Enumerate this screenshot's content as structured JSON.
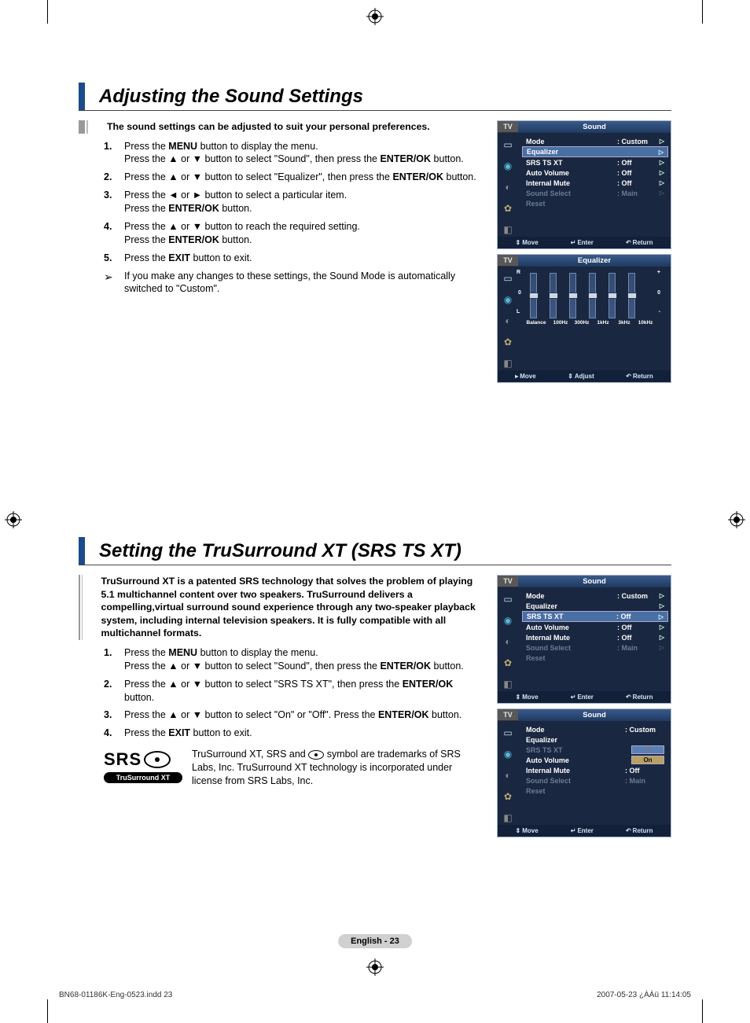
{
  "section1": {
    "title": "Adjusting the Sound Settings",
    "intro": "The sound settings can be adjusted to suit your personal preferences.",
    "steps": [
      {
        "num": "1.",
        "a": "Press the ",
        "b1": "MENU",
        "c": " button to display the menu.",
        "d": "Press the ▲ or ▼ button to select \"Sound\", then press the ",
        "b2": "ENTER/OK",
        "e": " button."
      },
      {
        "num": "2.",
        "a": "Press the ▲ or ▼ button to select \"Equalizer\", then press the ",
        "b1": "ENTER/OK",
        "c": " button."
      },
      {
        "num": "3.",
        "a": "Press the ◄ or ► button to select a particular item.",
        "d": "Press the ",
        "b2": "ENTER/OK",
        "e": " button."
      },
      {
        "num": "4.",
        "a": "Press the ▲ or ▼ button to reach the required setting.",
        "d": "Press the ",
        "b2": "ENTER/OK",
        "e": " button."
      },
      {
        "num": "5.",
        "a": "Press the ",
        "b1": "EXIT",
        "c": " button to exit."
      }
    ],
    "note_arrow": "➢",
    "note": "If you make any changes to these settings, the Sound Mode is automatically switched to \"Custom\"."
  },
  "section2": {
    "title": "Setting the TruSurround XT (SRS TS XT)",
    "intro": "TruSurround XT is a patented SRS technology that solves the problem of playing 5.1 multichannel content over two speakers. TruSurround delivers a compelling,virtual surround sound experience through any two-speaker playback system, including internal television speakers. It is fully compatible with all multichannel formats.",
    "steps": [
      {
        "num": "1.",
        "a": "Press the ",
        "b1": "MENU",
        "c": " button to display the menu.",
        "d": "Press the ▲ or ▼ button to select \"Sound\", then press the ",
        "b2": "ENTER/OK",
        "e": " button."
      },
      {
        "num": "2.",
        "a": "Press the ▲ or ▼ button to select \"SRS TS XT\", then press the ",
        "b1": "ENTER/OK",
        "c": " button."
      },
      {
        "num": "3.",
        "a": "Press the ▲ or ▼ button to select \"On\" or \"Off\". Press the ",
        "b1": "ENTER/OK",
        "c": " button."
      },
      {
        "num": "4.",
        "a": "Press the ",
        "b1": "EXIT",
        "c": " button to exit."
      }
    ],
    "tm_a": "TruSurround XT, SRS and ",
    "tm_b": " symbol are trademarks of SRS Labs, Inc. TruSurround XT technology is incorporated under license from SRS Labs, Inc.",
    "logo_main": "SRS",
    "logo_sub": "TruSurround XT"
  },
  "osd": {
    "tv": "TV",
    "sound_title": "Sound",
    "eq_title": "Equalizer",
    "mode_label": "Mode",
    "mode_val": ": Custom",
    "equalizer": "Equalizer",
    "srs": "SRS TS XT",
    "srs_val": ": Off",
    "autovol": "Auto Volume",
    "autovol_val": ": Off",
    "intmute": "Internal Mute",
    "intmute_val": ": Off",
    "sndsel": "Sound Select",
    "sndsel_val": ": Main",
    "reset": "Reset",
    "move": "Move",
    "enter": "Enter",
    "return": "Return",
    "adjust": "Adjust",
    "move_ico": "⇕",
    "enter_ico": "↵",
    "return_ico": "↶",
    "move_lr": "▸",
    "eq_labels": [
      "Balance",
      "100Hz",
      "300Hz",
      "1kHz",
      "3kHz",
      "10kHz"
    ],
    "eq_R": "R",
    "eq_L": "L",
    "eq_plus": "+",
    "eq_minus": "-",
    "eq_zero": "0",
    "dd_off": "Off",
    "dd_on": "On",
    "colon": ":"
  },
  "page_num": "English - 23",
  "footer_left": "BN68-01186K-Eng-0523.indd   23",
  "footer_right": "2007-05-23   ¿ÀÀü 11:14:05"
}
